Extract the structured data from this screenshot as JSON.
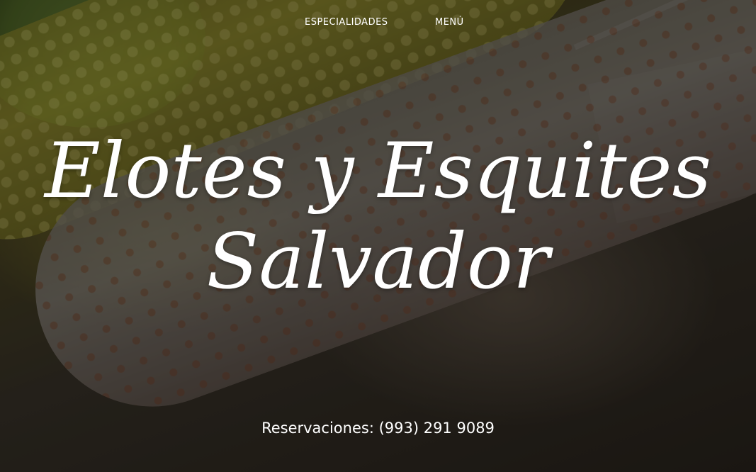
{
  "nav": {
    "items": [
      {
        "label": "ESPECIALIDADES"
      },
      {
        "label": "MENÚ"
      }
    ]
  },
  "hero": {
    "title_line1": "Elotes y Esquites",
    "title_line2": "Salvador",
    "reservations": "Reservaciones: (993) 291 9089"
  },
  "colors": {
    "text": "#ffffff",
    "overlay": "rgba(0,0,0,0.38)"
  }
}
